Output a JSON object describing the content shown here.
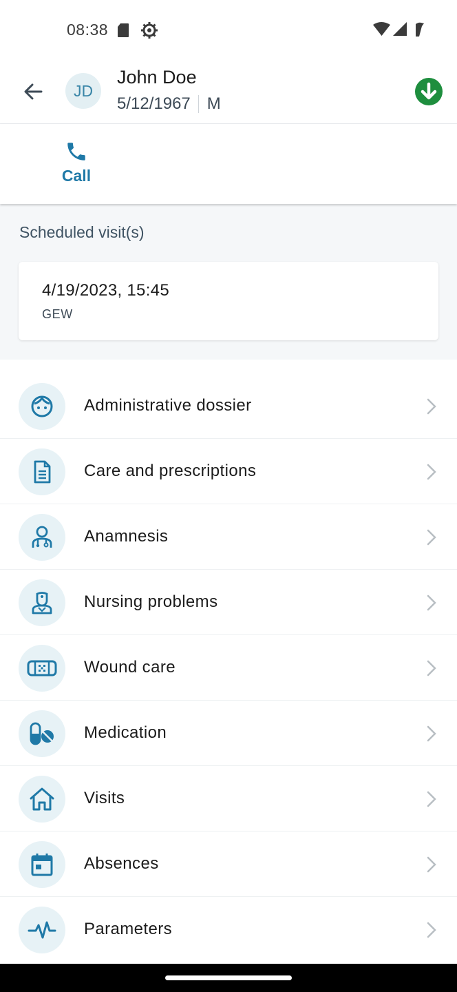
{
  "status_bar": {
    "time": "08:38"
  },
  "header": {
    "avatar_initials": "JD",
    "patient_name": "John Doe",
    "birth_date": "5/12/1967",
    "gender": "M",
    "sync_color": "#1e8e3e"
  },
  "actions": {
    "call_label": "Call"
  },
  "scheduled": {
    "title": "Scheduled visit(s)",
    "visits": [
      {
        "datetime": "4/19/2023, 15:45",
        "code": "GEW"
      }
    ]
  },
  "menu": {
    "items": [
      {
        "label": "Administrative dossier",
        "icon": "face-icon"
      },
      {
        "label": "Care and prescriptions",
        "icon": "document-icon"
      },
      {
        "label": "Anamnesis",
        "icon": "doctor-icon"
      },
      {
        "label": "Nursing problems",
        "icon": "nurse-icon"
      },
      {
        "label": "Wound care",
        "icon": "bandage-icon"
      },
      {
        "label": "Medication",
        "icon": "pills-icon"
      },
      {
        "label": "Visits",
        "icon": "home-icon"
      },
      {
        "label": "Absences",
        "icon": "calendar-icon"
      },
      {
        "label": "Parameters",
        "icon": "pulse-icon"
      }
    ]
  },
  "colors": {
    "accent": "#1f79a7",
    "icon_bg": "#e7f2f6",
    "section_bg": "#f5f7f9"
  }
}
